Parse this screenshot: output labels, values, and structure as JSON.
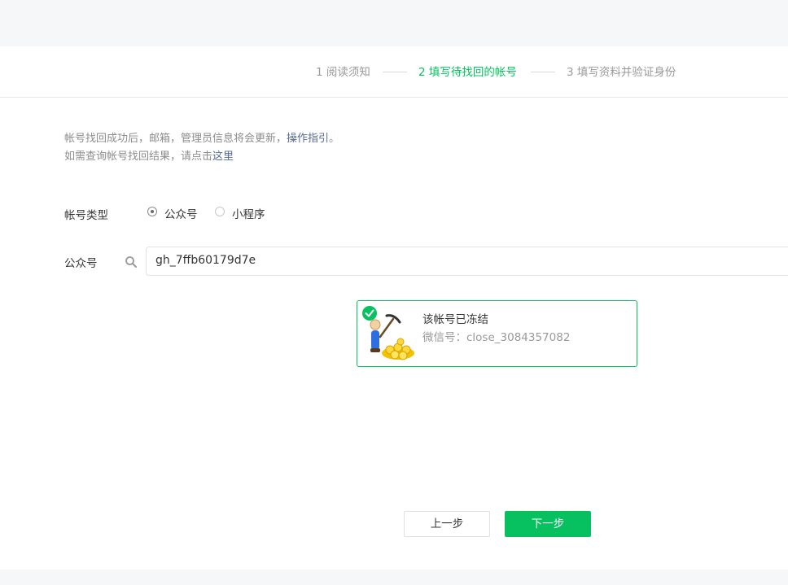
{
  "steps": [
    {
      "label": "1 阅读须知"
    },
    {
      "label": "2 填写待找回的帐号"
    },
    {
      "label": "3 填写资料并验证身份"
    }
  ],
  "notice": {
    "line1_prefix": "帐号找回成功后，邮箱，管理员信息将会更新，",
    "line1_link": "操作指引",
    "line1_suffix": "。",
    "line2_prefix": "如需查询帐号找回结果，请点击",
    "line2_link": "这里"
  },
  "form": {
    "account_type_label": "帐号类型",
    "account_type_options": [
      {
        "label": "公众号",
        "checked": true
      },
      {
        "label": "小程序",
        "checked": false
      }
    ],
    "account_label": "公众号",
    "account_value": "gh_7ffb60179d7e"
  },
  "result": {
    "title": "该帐号已冻结",
    "wechat_id": "微信号：close_3084357082"
  },
  "buttons": {
    "prev": "上一步",
    "next": "下一步"
  },
  "colors": {
    "accent": "#07c160",
    "link": "#576b95"
  }
}
